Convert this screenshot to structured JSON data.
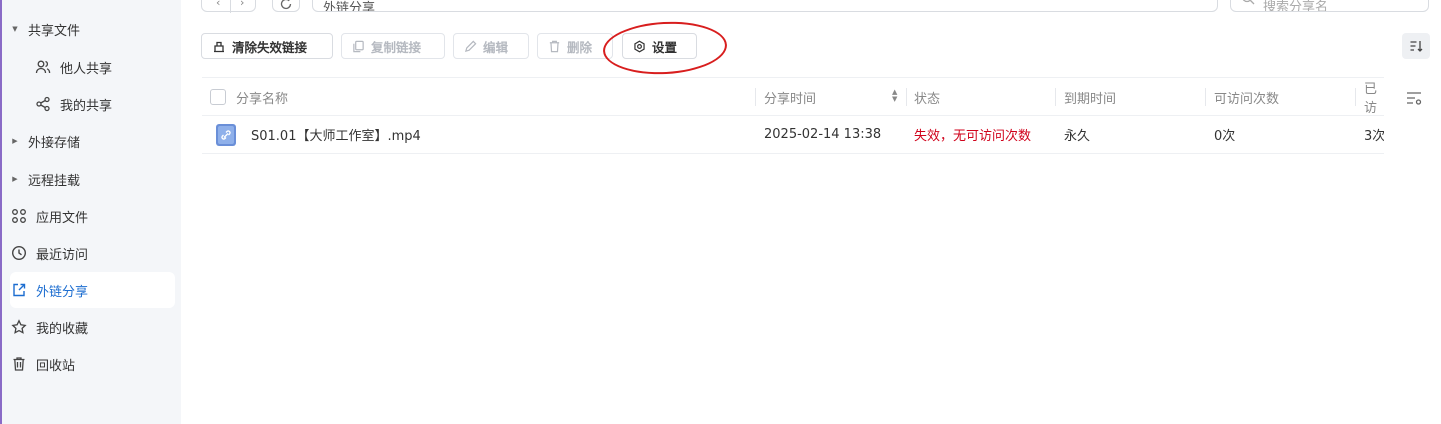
{
  "sidebar": {
    "items": [
      {
        "label": "共享文件",
        "icon": "caret-down-icon",
        "expanded": true
      },
      {
        "label": "他人共享",
        "icon": "users-icon"
      },
      {
        "label": "我的共享",
        "icon": "share-icon"
      },
      {
        "label": "外接存储",
        "icon": "caret-right-icon"
      },
      {
        "label": "远程挂载",
        "icon": "caret-right-icon"
      },
      {
        "label": "应用文件",
        "icon": "command-icon"
      },
      {
        "label": "最近访问",
        "icon": "clock-icon"
      },
      {
        "label": "外链分享",
        "icon": "external-share-icon",
        "active": true
      },
      {
        "label": "我的收藏",
        "icon": "star-icon"
      },
      {
        "label": "回收站",
        "icon": "trash-icon"
      }
    ]
  },
  "topbar": {
    "path": "外链分享",
    "search_placeholder": "搜索分享名"
  },
  "toolbar": {
    "clear_invalid": "清除失效链接",
    "copy_link": "复制链接",
    "edit": "编辑",
    "delete": "删除",
    "settings": "设置"
  },
  "table": {
    "headers": {
      "name": "分享名称",
      "share_time": "分享时间",
      "status": "状态",
      "expire_time": "到期时间",
      "access_count": "可访问次数",
      "visited": "已访"
    },
    "rows": [
      {
        "name": "S01.01【大师工作室】.mp4",
        "share_time": "2025-02-14 13:38",
        "status": "失效，无可访问次数",
        "expire_time": "永久",
        "access_count": "0次",
        "visited": "3次"
      }
    ]
  },
  "colors": {
    "accent": "#1c6dd0",
    "status_invalid": "#d0021b",
    "highlight_ring": "#d81e1e"
  }
}
